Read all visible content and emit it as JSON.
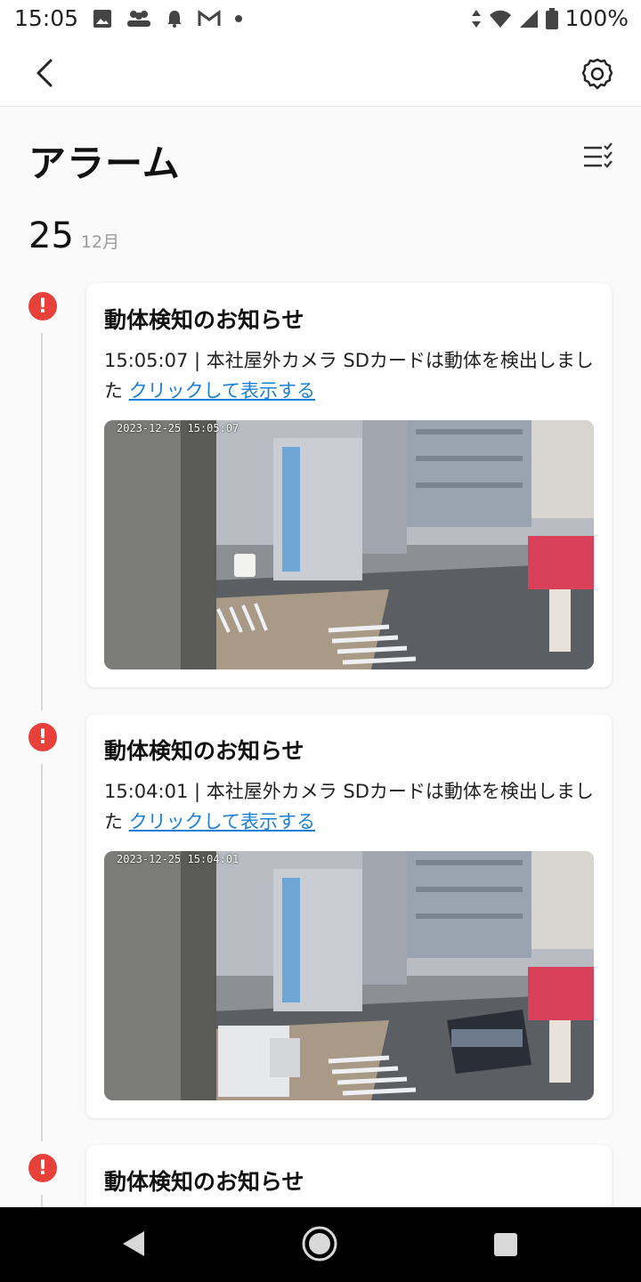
{
  "status_bar": {
    "time": "15:05",
    "battery": "100%",
    "left_icons": [
      "image-icon",
      "people-icon",
      "bell-icon",
      "gmail-icon",
      "dot-icon"
    ],
    "right_icons": [
      "data-arrows-icon",
      "wifi-icon",
      "signal-icon",
      "battery-icon"
    ]
  },
  "app_bar": {
    "back_icon": "chevron-left-icon",
    "settings_icon": "gear-icon"
  },
  "page": {
    "title": "アラーム",
    "filter_icon": "list-check-icon"
  },
  "date_group": {
    "day": "25",
    "month": "12月"
  },
  "alarms": [
    {
      "title": "動体検知のお知らせ",
      "desc": "15:05:07 | 本社屋外カメラ SDカードは動体を検出しました ",
      "link": "クリックして表示する",
      "camera_stamp": "2023-12-25 15:05:07"
    },
    {
      "title": "動体検知のお知らせ",
      "desc": "15:04:01 | 本社屋外カメラ SDカードは動体を検出しました ",
      "link": "クリックして表示する",
      "camera_stamp": "2023-12-25 15:04:01"
    },
    {
      "title": "動体検知のお知らせ",
      "desc": "",
      "link": "",
      "camera_stamp": ""
    }
  ],
  "colors": {
    "alert_red": "#e8413b",
    "link_blue": "#1a7fd8",
    "navbar_bg": "#000000"
  },
  "nav_bar": {
    "icons": [
      "nav-back-icon",
      "nav-home-icon",
      "nav-recent-icon"
    ]
  }
}
